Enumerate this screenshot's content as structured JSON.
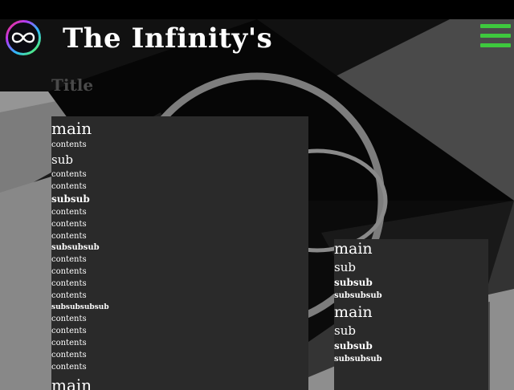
{
  "header": {
    "site_title": "The Infinity's",
    "logo_icon": "infinity-logo-icon",
    "menu_icon": "hamburger-menu-icon",
    "menu_color": "#3ec93e"
  },
  "page": {
    "title": "Title"
  },
  "main_panel": {
    "h_main": "main",
    "c1": "contents",
    "h_sub": "sub",
    "c2": "contents",
    "c3": "contents",
    "h_subsub": "subsub",
    "c4": "contents",
    "c5": "contents",
    "c6": "contents",
    "h_subsubsub": "subsubsub",
    "c7": "contents",
    "c8": "contents",
    "c9": "contents",
    "c10": "contents",
    "h_subsubsubsub": "subsubsubsub",
    "c11": "contents",
    "c12": "contents",
    "c13": "contents",
    "c14": "contents",
    "c15": "contents",
    "h_main2": "main"
  },
  "side_panel": {
    "h_main1": "main",
    "h_sub1": "sub",
    "h_subsub1": "subsub",
    "h_subsubsub1": "subsubsub",
    "h_main2": "main",
    "h_sub2": "sub",
    "h_subsub2": "subsub",
    "h_subsubsub2": "subsubsub"
  }
}
